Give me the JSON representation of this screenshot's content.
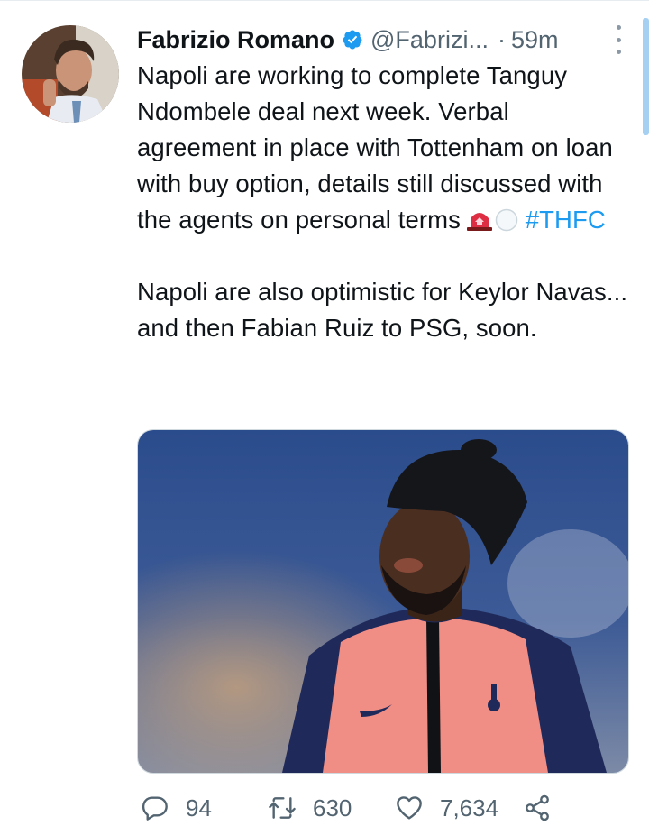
{
  "tweet": {
    "author": {
      "display_name": "Fabrizio Romano",
      "handle": "@Fabrizi...",
      "verified": true
    },
    "separator": "·",
    "time": "59m",
    "text": {
      "paragraph1": "Napoli are working to complete Tanguy Ndombele deal next week. Verbal agreement in place with Tottenham on loan with buy option, details still discussed with the agents on personal terms",
      "emojis": [
        "🚨",
        "⚪"
      ],
      "hashtag": "#THFC",
      "paragraph2": "Napoli are also optimistic for Keylor Navas... and then Fabian Ruiz to PSG, soon."
    },
    "stats": {
      "replies": "94",
      "retweets": "630",
      "likes": "7,634"
    }
  },
  "colors": {
    "text": "#0f1419",
    "secondary": "#536471",
    "link": "#1d9bf0",
    "verified": "#1d9bf0"
  },
  "icons": [
    "more-icon",
    "verified-icon",
    "reply-icon",
    "retweet-icon",
    "like-icon",
    "share-icon"
  ]
}
